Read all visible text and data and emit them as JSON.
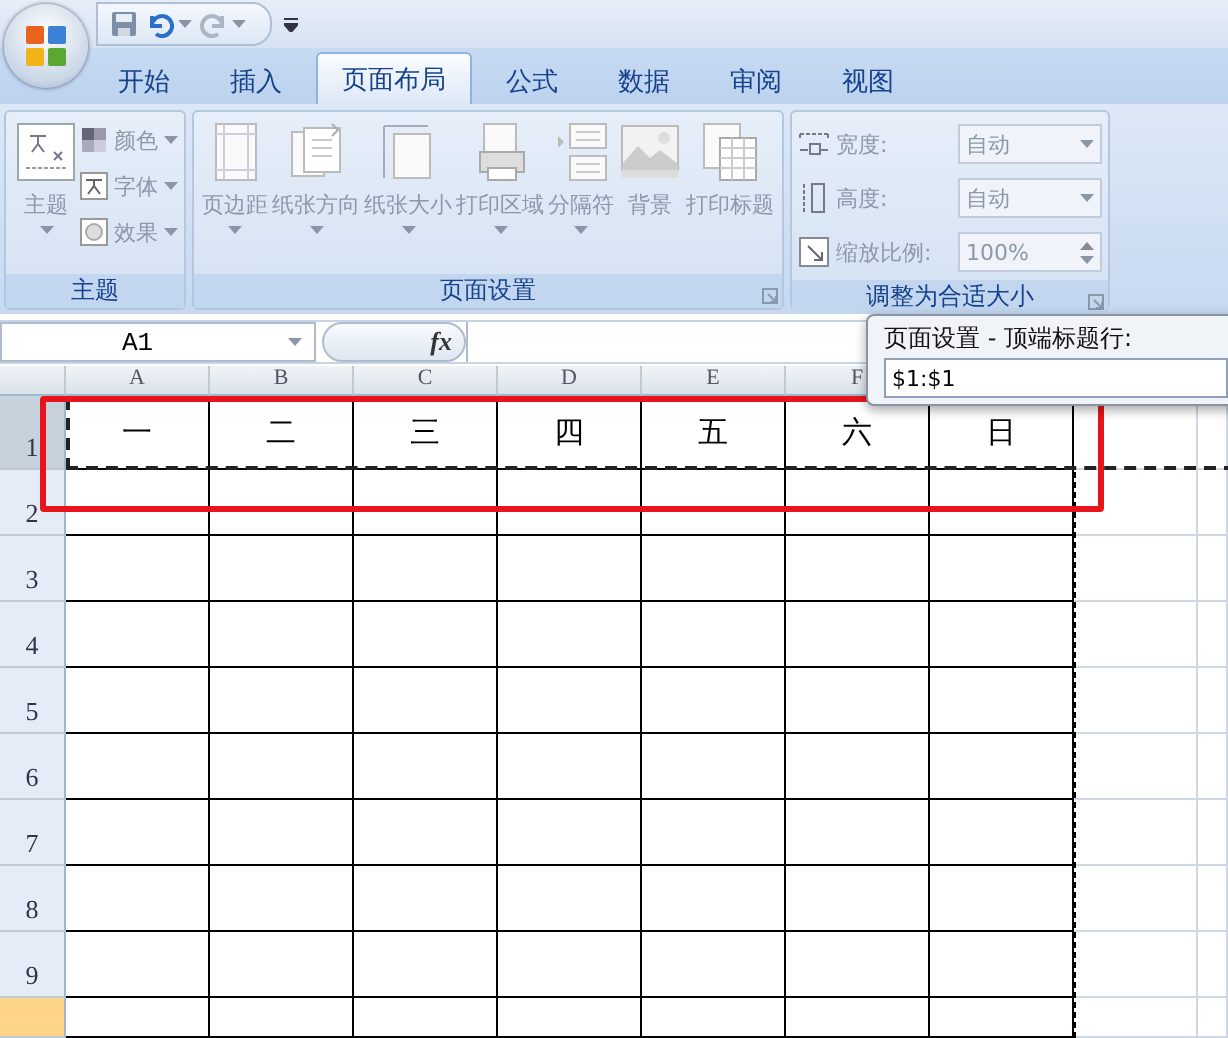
{
  "tabs": [
    {
      "label": "开始",
      "selected": false
    },
    {
      "label": "插入",
      "selected": false
    },
    {
      "label": "页面布局",
      "selected": true
    },
    {
      "label": "公式",
      "selected": false
    },
    {
      "label": "数据",
      "selected": false
    },
    {
      "label": "审阅",
      "selected": false
    },
    {
      "label": "视图",
      "selected": false
    }
  ],
  "ribbon": {
    "disabled": true,
    "groups": [
      {
        "label": "主题",
        "launcher": false,
        "items": [
          {
            "kind": "large",
            "label": "主题",
            "dropdown": true
          },
          {
            "kind": "small",
            "label": "颜色",
            "dropdown": true
          },
          {
            "kind": "small",
            "label": "字体",
            "dropdown": true
          },
          {
            "kind": "small",
            "label": "效果",
            "dropdown": true
          }
        ]
      },
      {
        "label": "页面设置",
        "launcher": true,
        "items": [
          {
            "kind": "large",
            "label": "页边距",
            "dropdown": true
          },
          {
            "kind": "large",
            "label": "纸张方向",
            "dropdown": true
          },
          {
            "kind": "large",
            "label": "纸张大小",
            "dropdown": true
          },
          {
            "kind": "large",
            "label": "打印区域",
            "dropdown": true
          },
          {
            "kind": "large",
            "label": "分隔符",
            "dropdown": true
          },
          {
            "kind": "large",
            "label": "背景",
            "dropdown": false
          },
          {
            "kind": "large",
            "label": "打印标题",
            "dropdown": false
          }
        ]
      },
      {
        "label": "调整为合适大小",
        "launcher": true,
        "items": [
          {
            "kind": "dropdown",
            "label": "宽度:",
            "value": "自动"
          },
          {
            "kind": "dropdown",
            "label": "高度:",
            "value": "自动"
          },
          {
            "kind": "spinner",
            "label": "缩放比例:",
            "value": "100%"
          }
        ]
      }
    ]
  },
  "formula_bar": {
    "name_box": "A1",
    "fx": "fx"
  },
  "sheet": {
    "columns": [
      "A",
      "B",
      "C",
      "D",
      "E",
      "F"
    ],
    "rows": [
      {
        "header": "1",
        "selected": true,
        "hovered": false,
        "cells": [
          "一",
          "二",
          "三",
          "四",
          "五",
          "六",
          "日"
        ]
      },
      {
        "header": "2",
        "selected": false,
        "hovered": false
      },
      {
        "header": "3",
        "selected": false,
        "hovered": false
      },
      {
        "header": "4",
        "selected": false,
        "hovered": false
      },
      {
        "header": "5",
        "selected": false,
        "hovered": false
      },
      {
        "header": "6",
        "selected": false,
        "hovered": false
      },
      {
        "header": "7",
        "selected": false,
        "hovered": false
      },
      {
        "header": "8",
        "selected": false,
        "hovered": false
      },
      {
        "header": "9",
        "selected": false,
        "hovered": false
      },
      {
        "selected": false,
        "hovered": true
      }
    ]
  },
  "dialog": {
    "title": "页面设置 - 顶端标题行:",
    "value": "$1:$1"
  }
}
